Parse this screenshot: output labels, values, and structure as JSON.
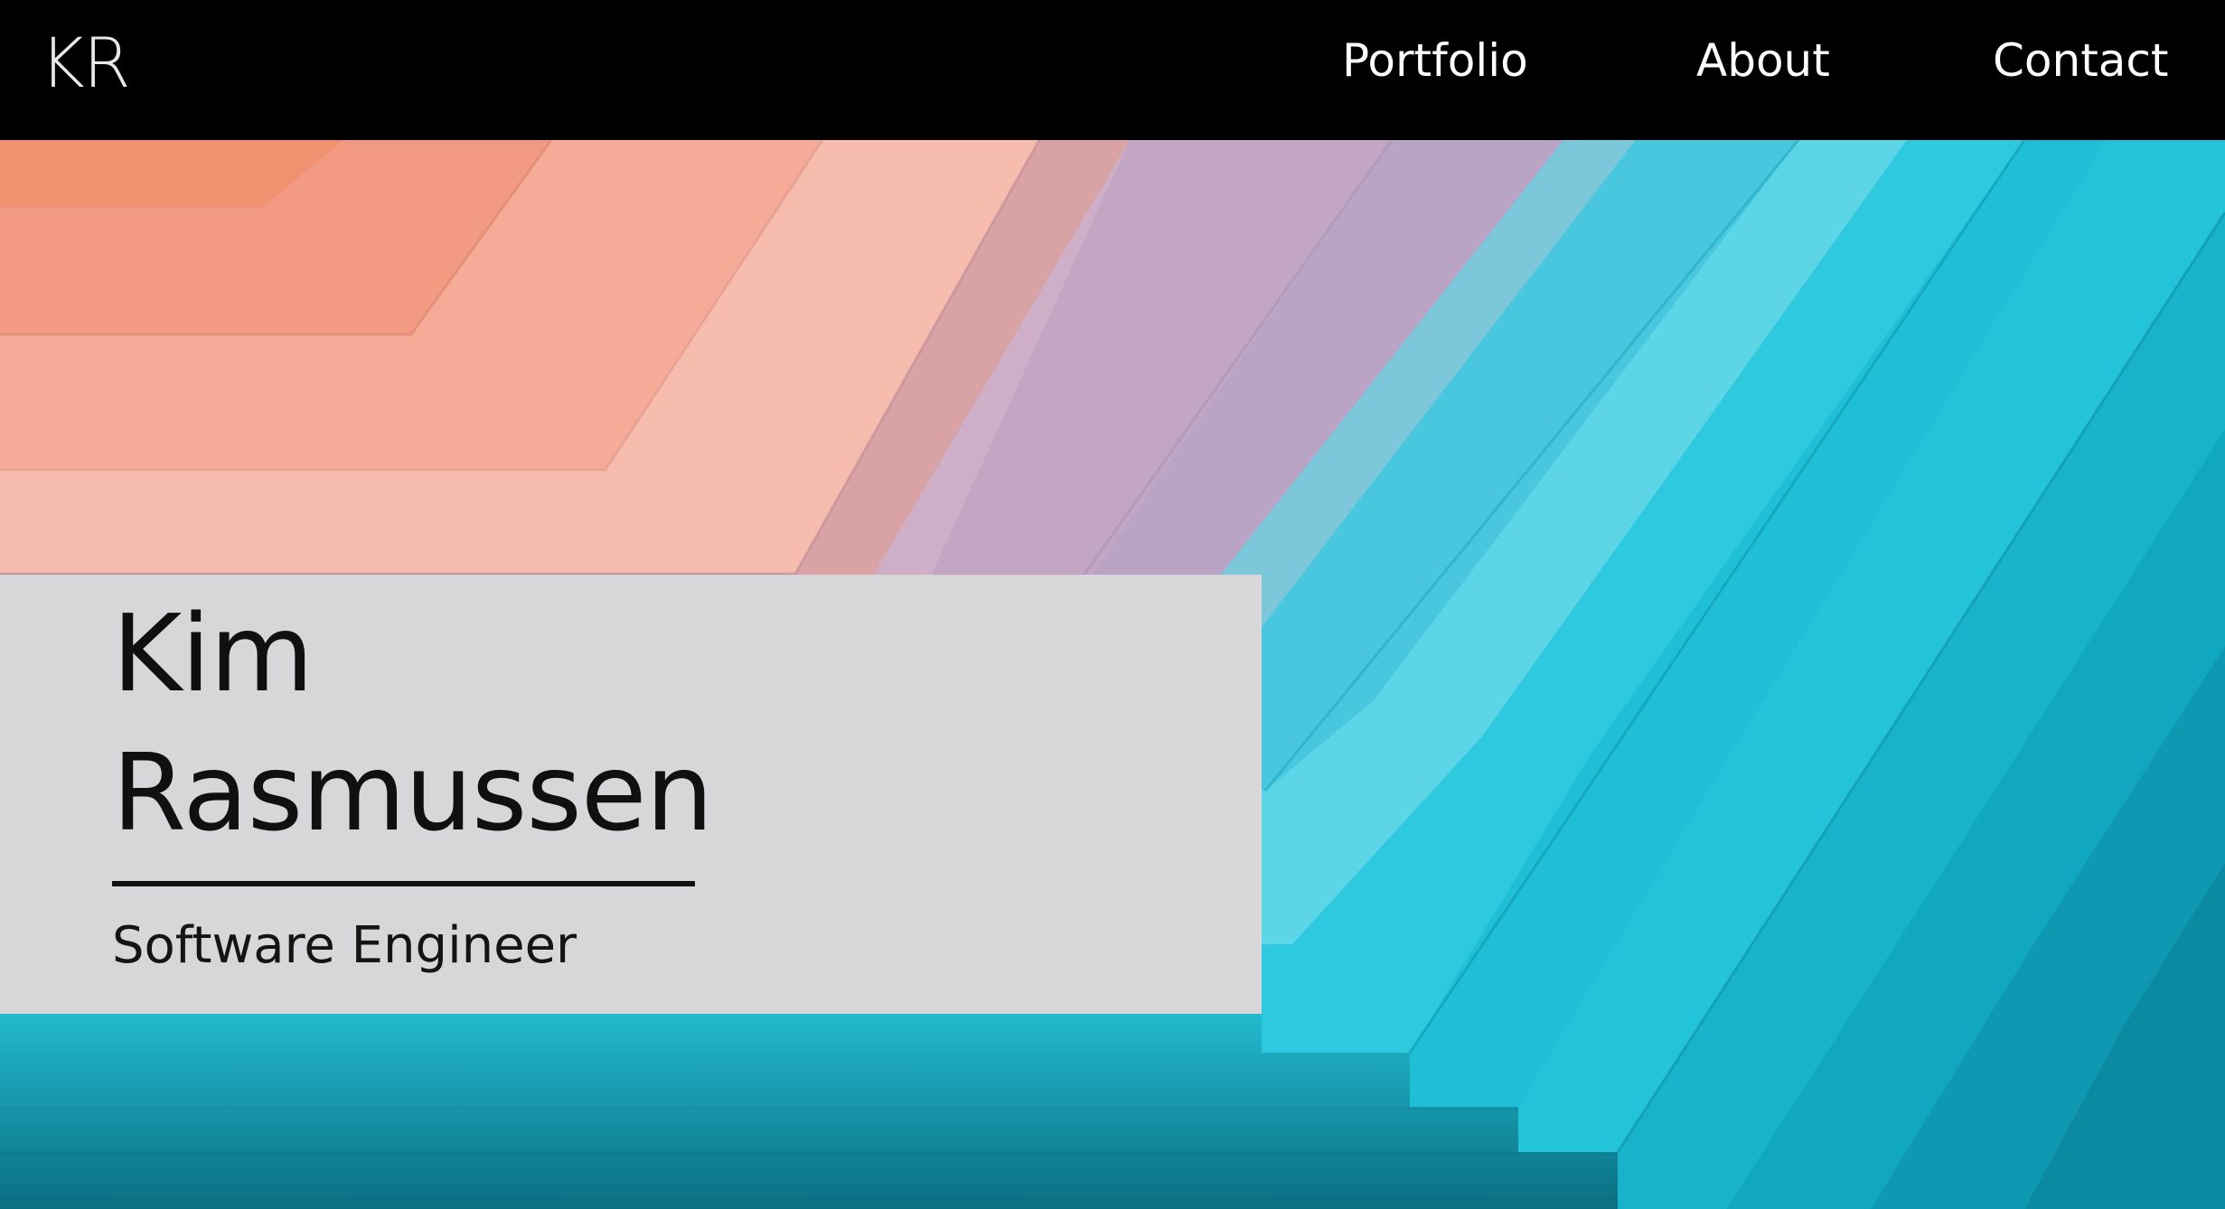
{
  "nav": {
    "logo": "KR",
    "links": [
      {
        "label": "Portfolio"
      },
      {
        "label": "About"
      },
      {
        "label": "Contact"
      }
    ]
  },
  "hero": {
    "background": "colorful-folded-paper-stripes",
    "name_first": "Kim",
    "name_last": "Rasmussen",
    "role": "Software Engineer"
  },
  "colors": {
    "nav_bg": "#000000",
    "card_bg": "#d7d6d9",
    "text_dark": "#101010",
    "coral": "#f2856a",
    "peach": "#f7b7a8",
    "lavender": "#c7a9c6",
    "cyan": "#22c8de",
    "teal": "#0b8aa0"
  }
}
